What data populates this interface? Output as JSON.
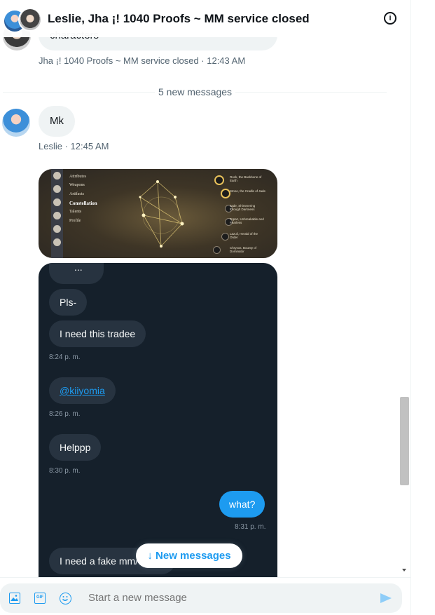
{
  "header": {
    "title": "Leslie, Jha ¡! 1040 Proofs ~ MM service closed",
    "info_icon": "info-icon"
  },
  "messages": {
    "prev": {
      "text_partial": "characters",
      "meta": "Jha ¡! 1040 Proofs ~ MM service closed · 12:43 AM"
    },
    "divider": "5 new messages",
    "mk": {
      "text": "Mk",
      "meta": "Leslie · 12:45 AM"
    }
  },
  "game_image": {
    "menu": [
      "Attributes",
      "Weapons",
      "Artifacts",
      "Constellation",
      "Talents",
      "Profile"
    ],
    "constellations": [
      "Rock, the Backbone of Earth",
      "Stone, the Cradle of Jade",
      "Jade, Shimmering through Darkness",
      "Topaz, Unbreakable and Fearless",
      "Lazuli, Herald of the Order",
      "Chrysos, Bounty of Dominator"
    ]
  },
  "screenshot": {
    "partial_top": "...",
    "messages": [
      {
        "text": "Pls-",
        "time": ""
      },
      {
        "text": "I need this tradee",
        "time": "8:24 p. m."
      },
      {
        "text": "@kiiyomia",
        "time": "8:26 p. m."
      },
      {
        "text": "Helppp",
        "time": "8:30 p. m."
      },
      {
        "text": "what?",
        "time": "8:31 p. m."
      },
      {
        "text": "I need a fake mm/",
        "time": ""
      }
    ]
  },
  "new_messages_button": "↓ New messages",
  "composer": {
    "placeholder": "Start a new message",
    "icons": [
      "image-icon",
      "gif-icon",
      "emoji-icon",
      "send-icon"
    ]
  }
}
